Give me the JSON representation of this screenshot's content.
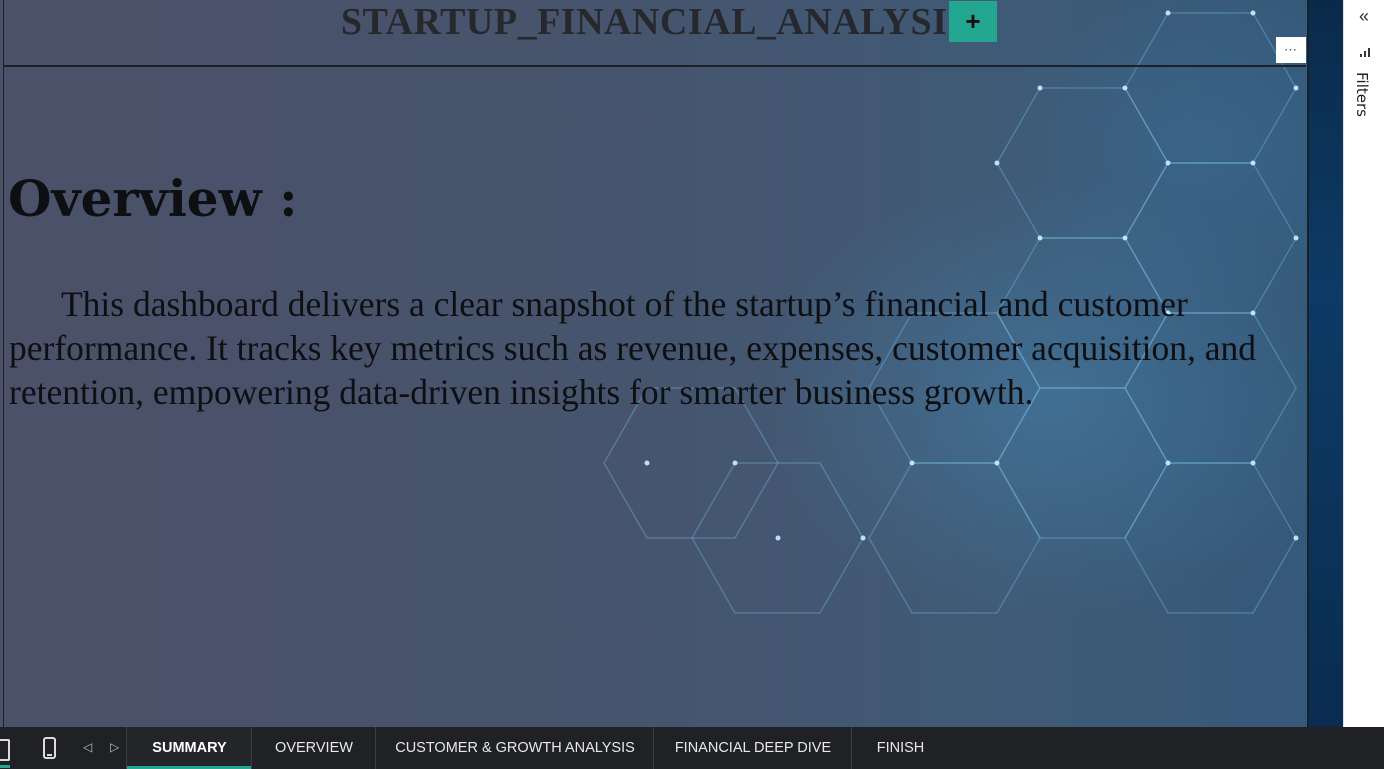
{
  "report": {
    "title": "STARTUP_FINANCIAL_ANALYSIS",
    "more_options": "⋯"
  },
  "content": {
    "heading": "Overview :",
    "body": "This dashboard delivers a clear snapshot of the startup’s financial and customer performance. It tracks key metrics such as revenue, expenses, customer acquisition, and retention, empowering data-driven insights for smarter business growth."
  },
  "filters_pane": {
    "label": "Filters",
    "collapse_icon": "«"
  },
  "navigation": {
    "prev": "◁",
    "next": "▷"
  },
  "tabs": [
    {
      "label": "SUMMARY",
      "active": true
    },
    {
      "label": "OVERVIEW",
      "active": false
    },
    {
      "label": "CUSTOMER & GROWTH ANALYSIS",
      "active": false
    },
    {
      "label": "FINANCIAL DEEP DIVE",
      "active": false
    },
    {
      "label": "FINISH",
      "active": false
    }
  ],
  "add_tab": "+",
  "colors": {
    "accent": "#22a68f",
    "tabbar": "#1f2124"
  }
}
